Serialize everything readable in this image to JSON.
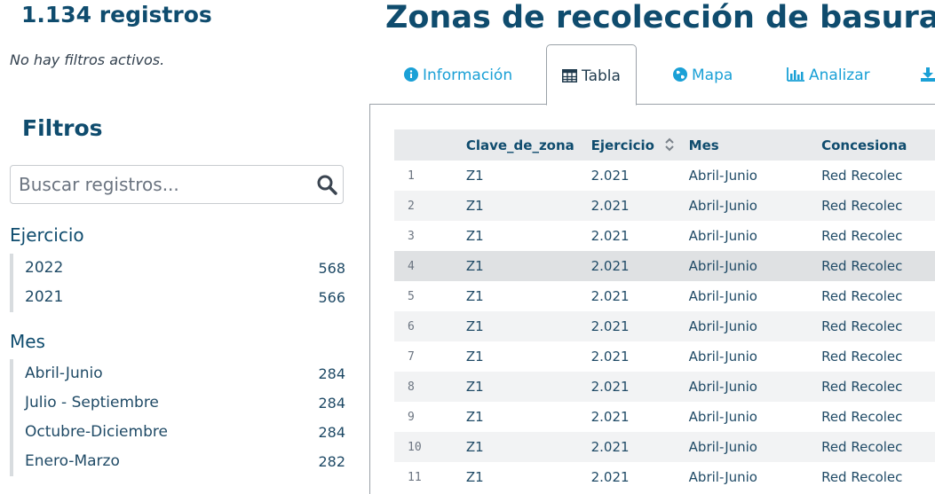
{
  "sidebar": {
    "count": "1.134 registros",
    "no_filters": "No hay filtros activos.",
    "filters_title": "Filtros",
    "search_placeholder": "Buscar registros...",
    "facets": [
      {
        "title": "Ejercicio",
        "items": [
          {
            "label": "2022",
            "count": "568"
          },
          {
            "label": "2021",
            "count": "566"
          }
        ]
      },
      {
        "title": "Mes",
        "items": [
          {
            "label": "Abril-Junio",
            "count": "284"
          },
          {
            "label": "Julio - Septiembre",
            "count": "284"
          },
          {
            "label": "Octubre-Diciembre",
            "count": "284"
          },
          {
            "label": "Enero-Marzo",
            "count": "282"
          }
        ]
      }
    ]
  },
  "main": {
    "title": "Zonas de recolección de basura -",
    "tabs": [
      {
        "label": "Información",
        "icon": "info-circle-icon"
      },
      {
        "label": "Tabla",
        "icon": "table-icon"
      },
      {
        "label": "Mapa",
        "icon": "globe-icon"
      },
      {
        "label": "Analizar",
        "icon": "bar-chart-icon"
      },
      {
        "label": "",
        "icon": "download-icon"
      }
    ],
    "table": {
      "headers": [
        "",
        "Clave_de_zona",
        "Ejercicio",
        "Mes",
        "Concesiona"
      ],
      "rows": [
        [
          "1",
          "Z1",
          "2.021",
          "Abril-Junio",
          "Red Recolec"
        ],
        [
          "2",
          "Z1",
          "2.021",
          "Abril-Junio",
          "Red Recolec"
        ],
        [
          "3",
          "Z1",
          "2.021",
          "Abril-Junio",
          "Red Recolec"
        ],
        [
          "4",
          "Z1",
          "2.021",
          "Abril-Junio",
          "Red Recolec"
        ],
        [
          "5",
          "Z1",
          "2.021",
          "Abril-Junio",
          "Red Recolec"
        ],
        [
          "6",
          "Z1",
          "2.021",
          "Abril-Junio",
          "Red Recolec"
        ],
        [
          "7",
          "Z1",
          "2.021",
          "Abril-Junio",
          "Red Recolec"
        ],
        [
          "8",
          "Z1",
          "2.021",
          "Abril-Junio",
          "Red Recolec"
        ],
        [
          "9",
          "Z1",
          "2.021",
          "Abril-Junio",
          "Red Recolec"
        ],
        [
          "10",
          "Z1",
          "2.021",
          "Abril-Junio",
          "Red Recolec"
        ],
        [
          "11",
          "Z1",
          "2.021",
          "Abril-Junio",
          "Red Recolec"
        ]
      ]
    }
  },
  "colors": {
    "title": "#0f4c6e",
    "link": "#1aa0d6",
    "header_bg": "#e8eaec",
    "row_alt": "#f2f3f4",
    "row_highlight": "#dfe1e3"
  }
}
